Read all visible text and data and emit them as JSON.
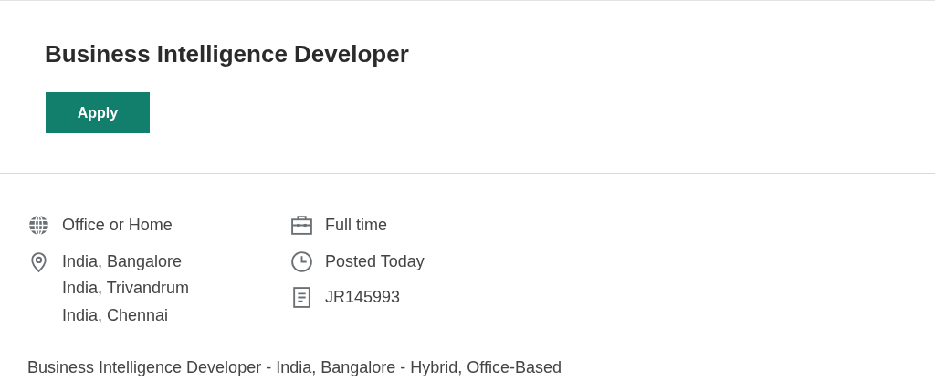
{
  "job": {
    "title": "Business Intelligence Developer",
    "apply_button": "Apply"
  },
  "details": [
    [
      {
        "kind": "globe",
        "lines": [
          "Office or Home"
        ]
      },
      {
        "kind": "pin",
        "lines": [
          "India, Bangalore",
          "India, Trivandrum",
          "India, Chennai"
        ]
      }
    ],
    [
      {
        "kind": "briefcase",
        "lines": [
          "Full time"
        ]
      },
      {
        "kind": "clock",
        "lines": [
          "Posted Today"
        ]
      },
      {
        "kind": "document",
        "lines": [
          "JR145993"
        ]
      }
    ]
  ],
  "summary": "Business Intelligence Developer - India, Bangalore - Hybrid, Office-Based"
}
